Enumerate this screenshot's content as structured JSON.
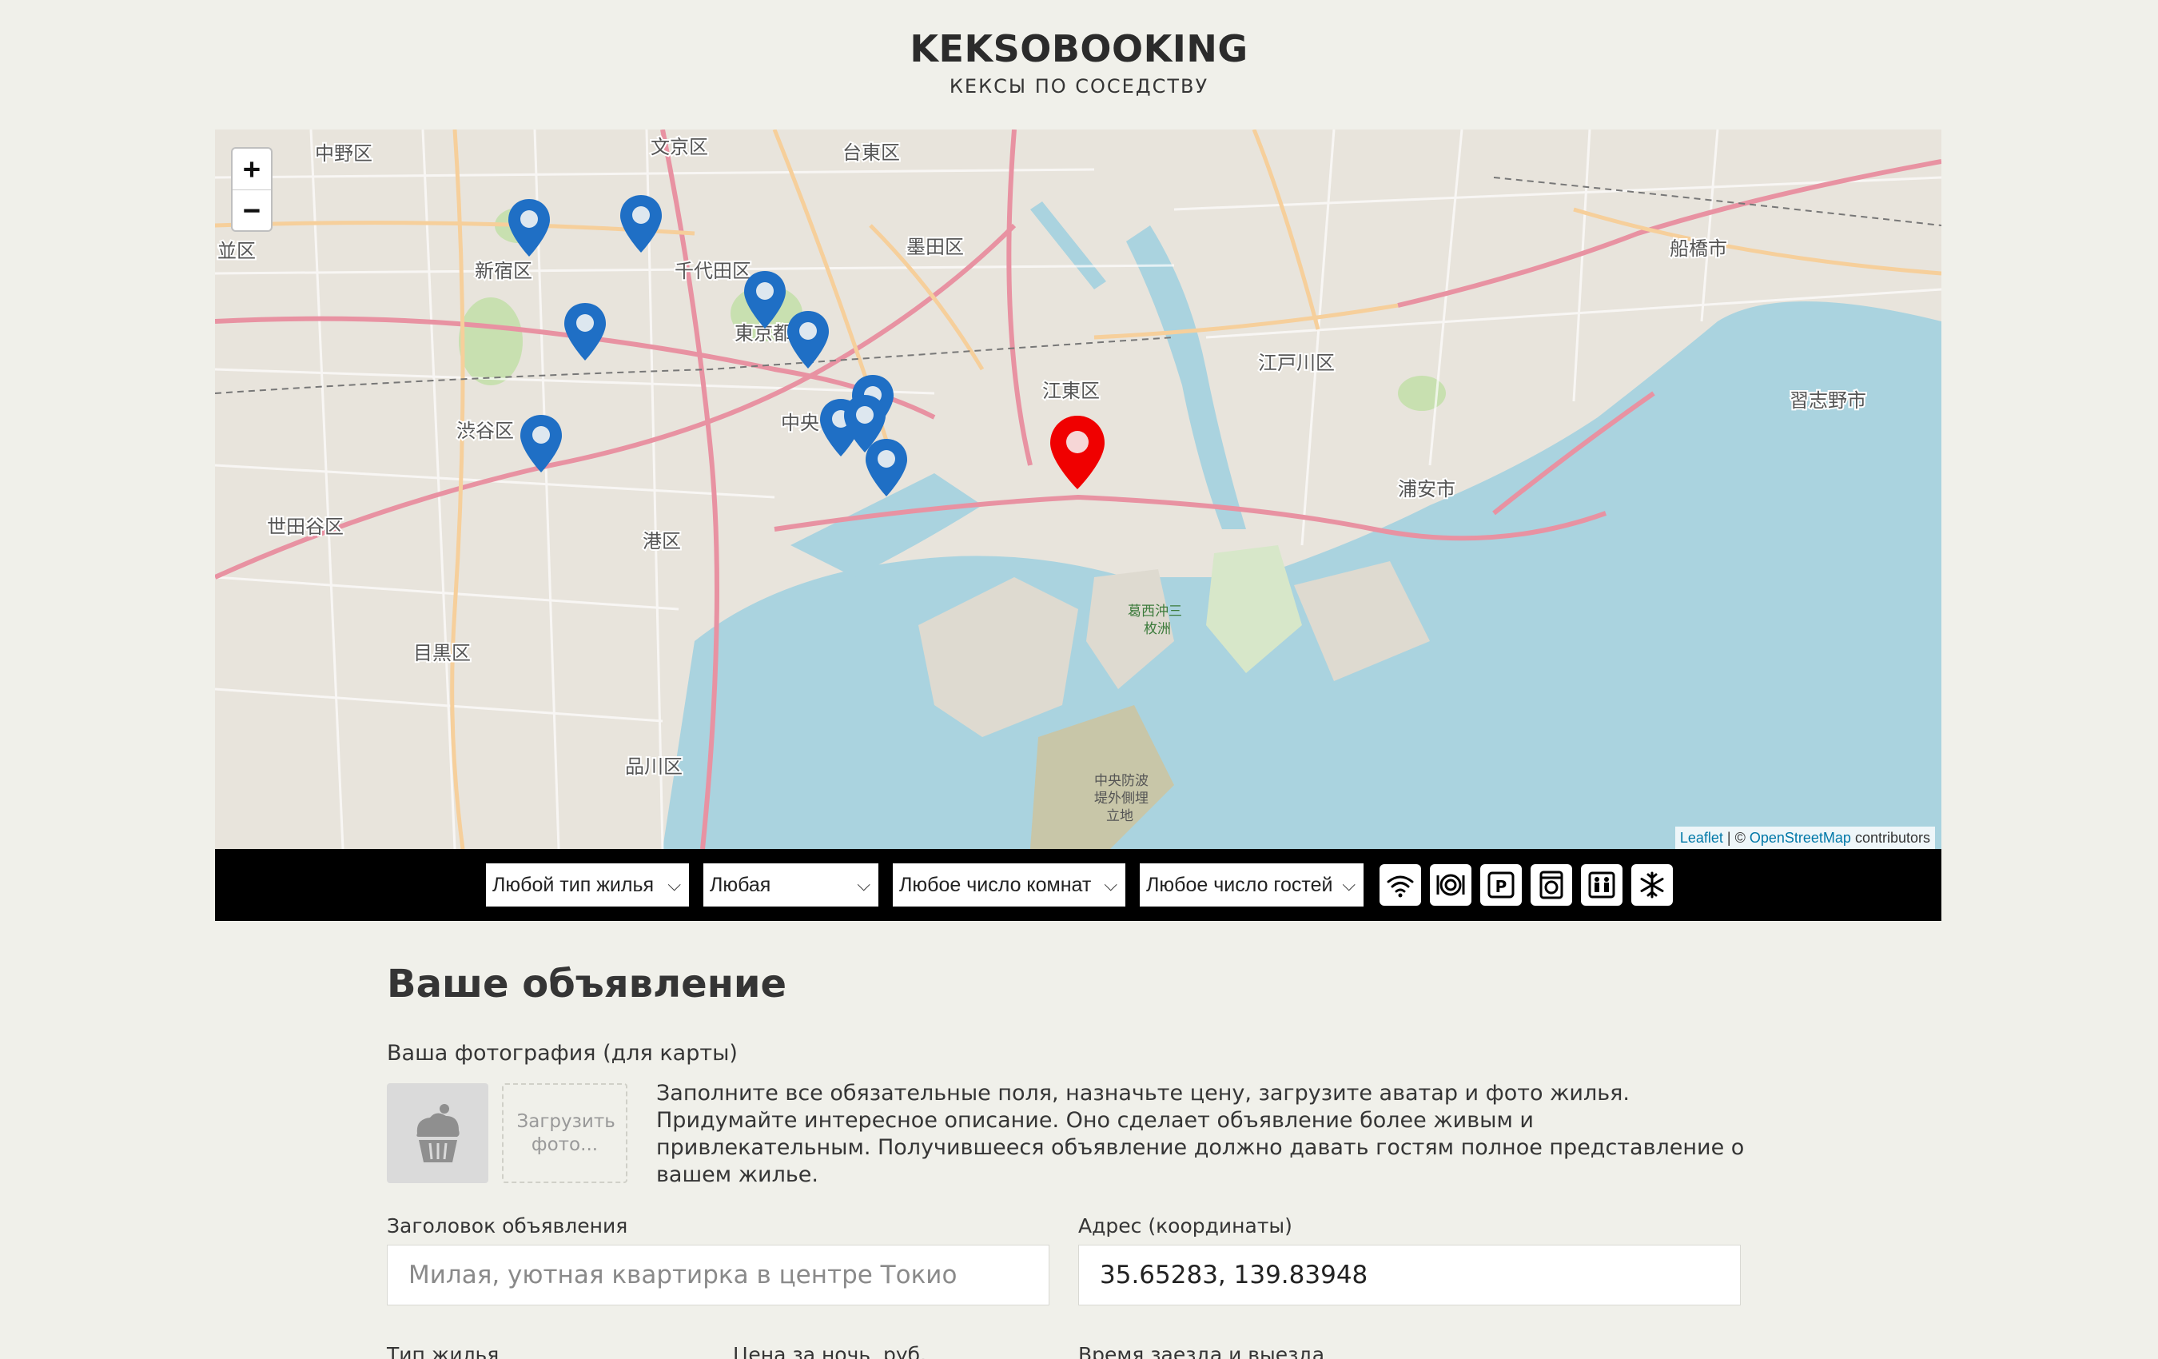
{
  "header": {
    "logo": "KEKSOBOOKING",
    "tagline": "КЕКСЫ ПО СОСЕДСТВУ"
  },
  "map": {
    "zoom_in": "+",
    "zoom_out": "−",
    "attribution": {
      "leaflet": "Leaflet",
      "separator": " | © ",
      "osm": "OpenStreetMap",
      "suffix": " contributors"
    },
    "place_labels": [
      "中野区",
      "文京区",
      "台東区",
      "墨田区",
      "新宿区",
      "千代田区",
      "東京都",
      "江東区",
      "江戸川区",
      "船橋市",
      "習志野市",
      "渋谷区",
      "中央",
      "浦安市",
      "世田谷区",
      "港区",
      "目黒区",
      "品川区",
      "並区",
      "葛西沖三枚洲",
      "中央防波堤外側埋立地"
    ],
    "main_pin_color": "#f00000",
    "ad_pin_color": "#1f6fc5",
    "ad_pin_count": 11
  },
  "filters": {
    "housing_type": "Любой тип жилья",
    "price": "Любая",
    "rooms": "Любое число комнат",
    "guests": "Любое число гостей",
    "features": [
      "wifi-icon",
      "dishwasher-icon",
      "parking-icon",
      "washer-icon",
      "elevator-icon",
      "conditioner-icon"
    ]
  },
  "form": {
    "title": "Ваше объявление",
    "photo_label": "Ваша фотография (для карты)",
    "upload_label": "Загрузить фото...",
    "note": "Заполните все обязательные поля, назначьте цену, загрузите аватар и фото жилья. Придумайте интересное описание. Оно сделает объявление более живым и привлекательным. Получившееся объявление должно давать гостям полное представление о вашем жилье.",
    "title_label": "Заголовок объявления",
    "title_placeholder": "Милая, уютная квартирка в центре Токио",
    "address_label": "Адрес (координаты)",
    "address_value": "35.65283, 139.83948",
    "type_label": "Тип жилья",
    "price_label": "Цена за ночь, руб.",
    "time_label": "Время заезда и выезда"
  }
}
